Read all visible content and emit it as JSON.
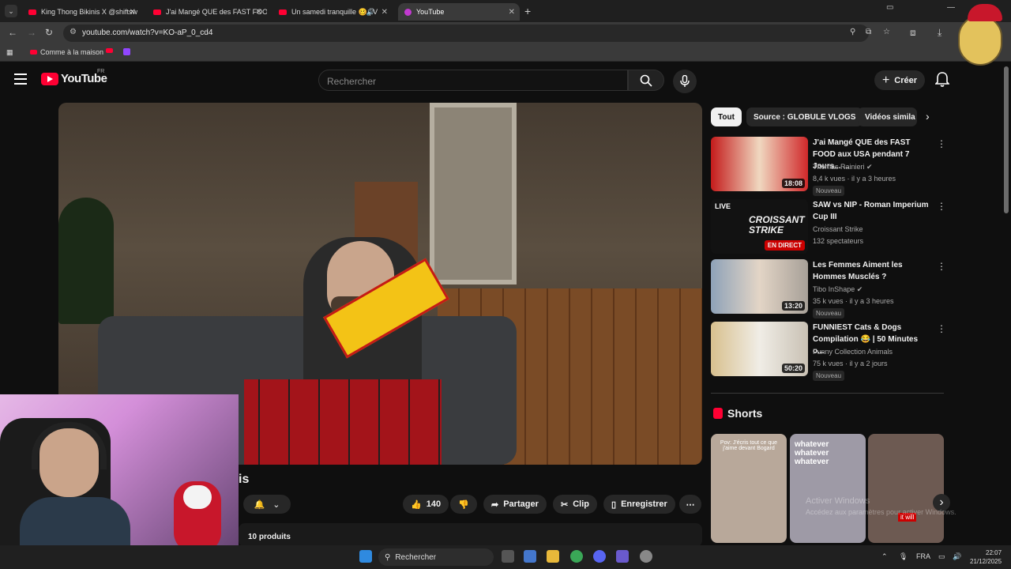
{
  "browser": {
    "tabs": [
      {
        "title": "King Thong Bikinis X @shiftsw"
      },
      {
        "title": "J'ai Mangé QUE des FAST FOO"
      },
      {
        "title": "Un samedi tranquille 🥴 | V"
      },
      {
        "title": "YouTube"
      }
    ],
    "url": "youtube.com/watch?v=KO-aP_0_cd4",
    "bookmarks": [
      {
        "label": "Comme à la maison"
      }
    ]
  },
  "youtube": {
    "logo_text": "YouTube",
    "region": "FR",
    "search_placeholder": "Rechercher",
    "create_label": "Créer"
  },
  "video": {
    "title_fragment": "is",
    "likes": "140",
    "share_label": "Partager",
    "clip_label": "Clip",
    "save_label": "Enregistrer",
    "products_label": "10 produits"
  },
  "chips": [
    {
      "label": "Tout",
      "selected": true
    },
    {
      "label": "Source : GLOBULE VLOGS",
      "selected": false
    },
    {
      "label": "Vidéos simila",
      "selected": false
    }
  ],
  "recommendations": [
    {
      "title": "J'ai Mangé QUE des FAST FOOD aux USA pendant 7 Jours... ...",
      "channel": "Thomas Rainieri",
      "meta": "8,4 k vues · il y a 3 heures",
      "duration": "18:08",
      "badge": "Nouveau",
      "verified": true
    },
    {
      "title": "SAW vs NIP - Roman Imperium Cup III",
      "channel": "Croissant Strike",
      "meta": "132 spectateurs",
      "duration": "",
      "badge": "",
      "live_label": "EN DIRECT",
      "thumb_text": "CROISSANT STRIKE",
      "live_tag": "LIVE"
    },
    {
      "title": "Les Femmes Aiment les Hommes Musclés ?",
      "channel": "Tibo InShape",
      "meta": "35 k vues · il y a 3 heures",
      "duration": "13:20",
      "badge": "Nouveau",
      "verified": true
    },
    {
      "title": "FUNNIEST Cats & Dogs Compilation 😂 | 50 Minutes o...",
      "channel": "Funny Collection Animals",
      "meta": "75 k vues · il y a 2 jours",
      "duration": "50:20",
      "badge": "Nouveau"
    }
  ],
  "shorts": {
    "heading": "Shorts",
    "items": [
      {
        "caption": "Pov: J'écris tout ce que j'aime devant Bogard",
        "color": "#b8a89a"
      },
      {
        "caption": "whatever whatever whatever",
        "color": "#9e9aa6"
      },
      {
        "caption": "it will",
        "color": "#6d5a52"
      }
    ]
  },
  "watermark": {
    "line1": "Activer Windows",
    "line2": "Accédez aux paramètres pour activer Windows."
  },
  "taskbar": {
    "search_label": "Rechercher",
    "lang": "FRA",
    "time": "22:07",
    "date": "21/12/2025"
  },
  "colors": {
    "accent": "#ff0033",
    "bg": "#0f0f0f",
    "chip": "#272727"
  }
}
